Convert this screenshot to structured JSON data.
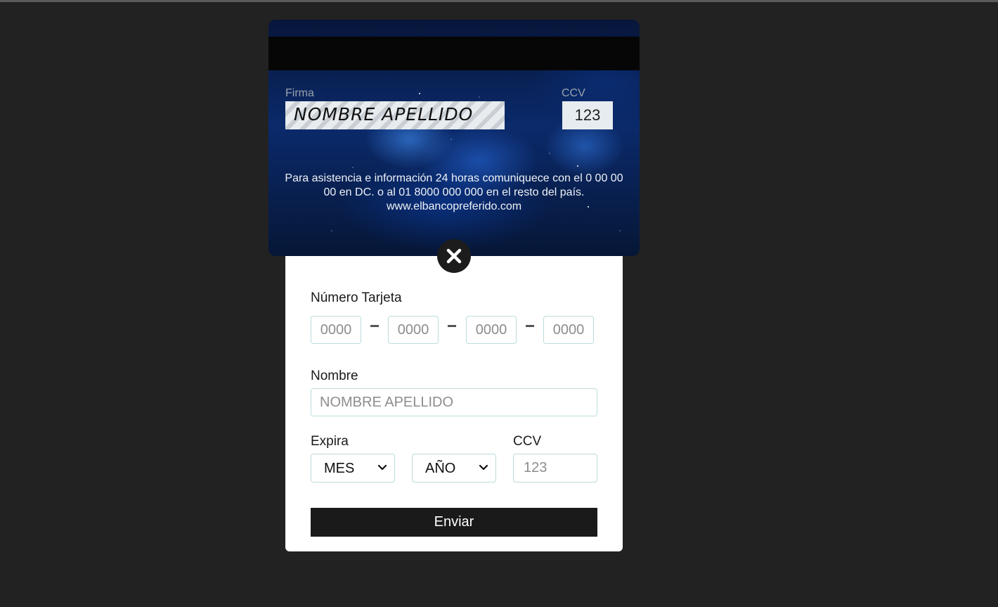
{
  "card": {
    "firma_label": "Firma",
    "signature": "NOMBRE APELLIDO",
    "ccv_label": "CCV",
    "ccv_value": "123",
    "info_line": "Para asistencia e información 24 horas comuniquece con el 0 00 00 00 en DC. o al 01 8000 000 000 en el resto del país.",
    "website": "www.elbancopreferido.com"
  },
  "form": {
    "number_label": "Número Tarjeta",
    "number_placeholders": [
      "0000",
      "0000",
      "0000",
      "0000"
    ],
    "name_label": "Nombre",
    "name_placeholder": "NOMBRE APELLIDO",
    "expira_label": "Expira",
    "month_selected": "MES",
    "year_selected": "AÑO",
    "ccv_label": "CCV",
    "ccv_placeholder": "123",
    "submit_label": "Enviar"
  },
  "icons": {
    "close": "close-icon",
    "select_arrow": "chevron-down-icon"
  },
  "colors": {
    "page_background": "#222222",
    "button_background": "#1a1a1a",
    "input_border": "#bcdcdc"
  }
}
